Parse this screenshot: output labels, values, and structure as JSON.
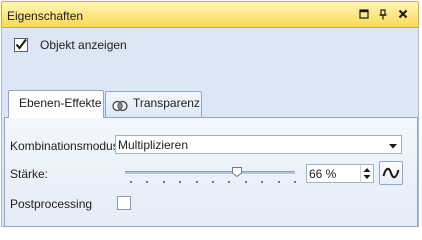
{
  "window": {
    "title": "Eigenschaften"
  },
  "show_object": {
    "label": "Objekt anzeigen",
    "checked": true
  },
  "tabs": [
    {
      "label": "Ebenen-Effekte",
      "active": true,
      "icon": ""
    },
    {
      "label": "Transparenz",
      "active": false,
      "icon": "transparency-icon"
    }
  ],
  "effects": {
    "blend_mode_label": "Kombinationsmodus:",
    "blend_mode_value": "Multiplizieren",
    "strength_label": "Stärke:",
    "strength_value": "66 %",
    "strength_fraction": 0.66,
    "postprocessing_label": "Postprocessing",
    "postprocessing_checked": false
  },
  "colors": {
    "title_bar": "#f9d85c",
    "panel_bg": "#dce6f4",
    "tab_border": "#8fa7c6"
  }
}
